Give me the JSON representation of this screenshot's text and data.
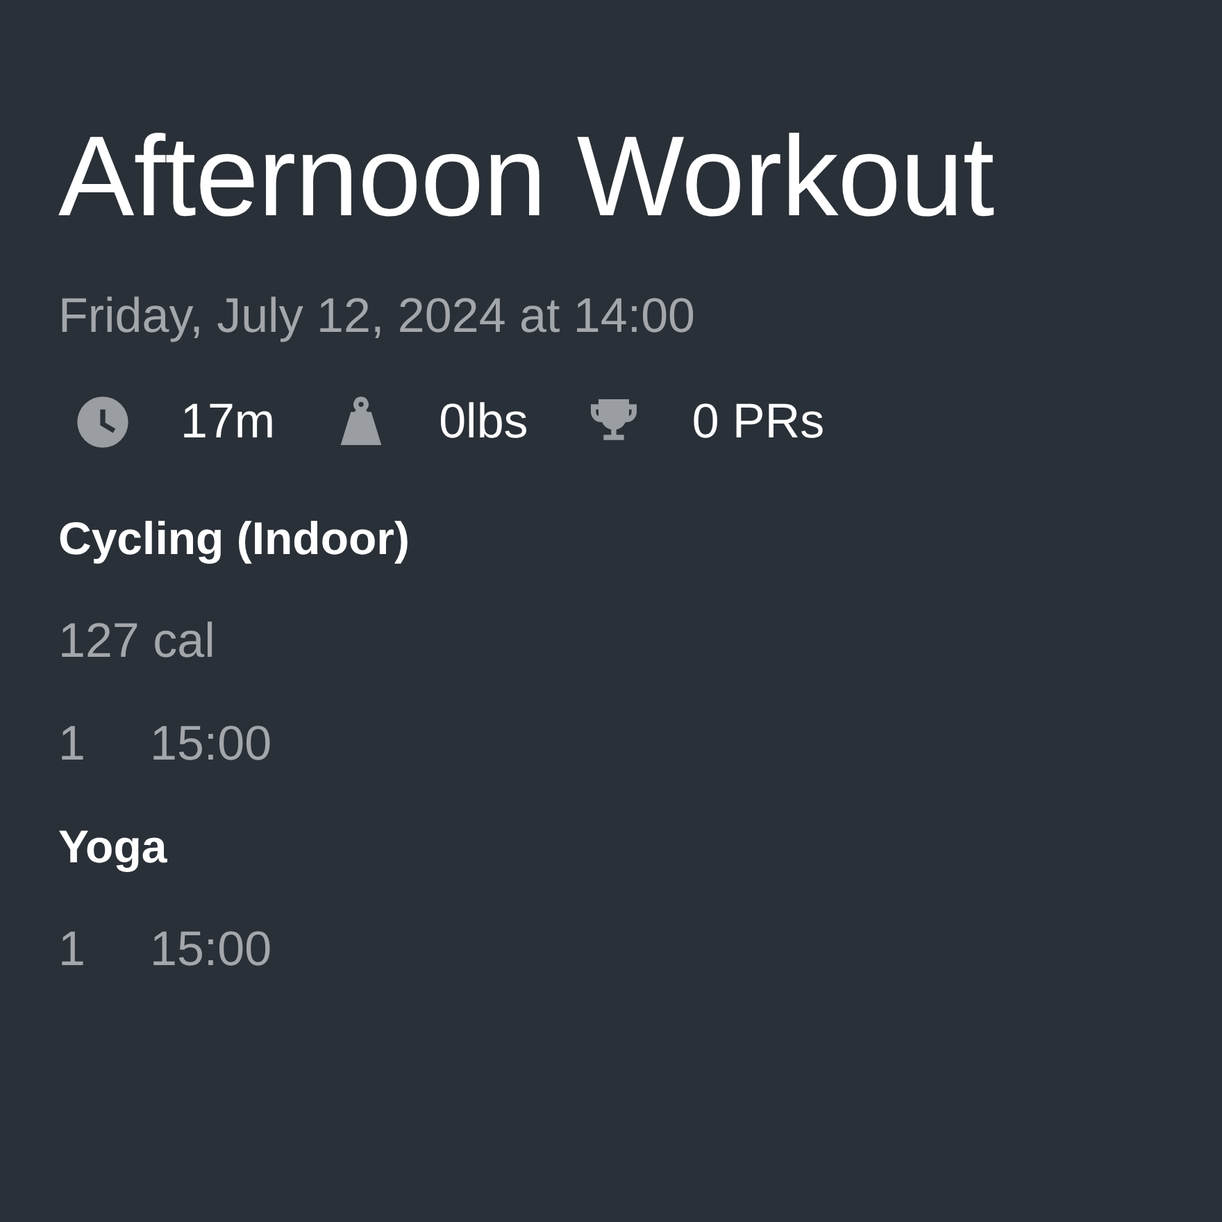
{
  "title": "Afternoon Workout",
  "date": "Friday, July 12, 2024 at 14:00",
  "stats": [
    {
      "kind": "duration",
      "value": "17m"
    },
    {
      "kind": "weight",
      "value": "0lbs"
    },
    {
      "kind": "prs",
      "value": "0 PRs"
    }
  ],
  "exercises": [
    {
      "name": "Cycling (Indoor)",
      "summary": "127 cal",
      "sets": [
        {
          "number": "1",
          "time": "15:00"
        }
      ]
    },
    {
      "name": "Yoga",
      "sets": [
        {
          "number": "1",
          "time": "15:00"
        }
      ]
    }
  ]
}
